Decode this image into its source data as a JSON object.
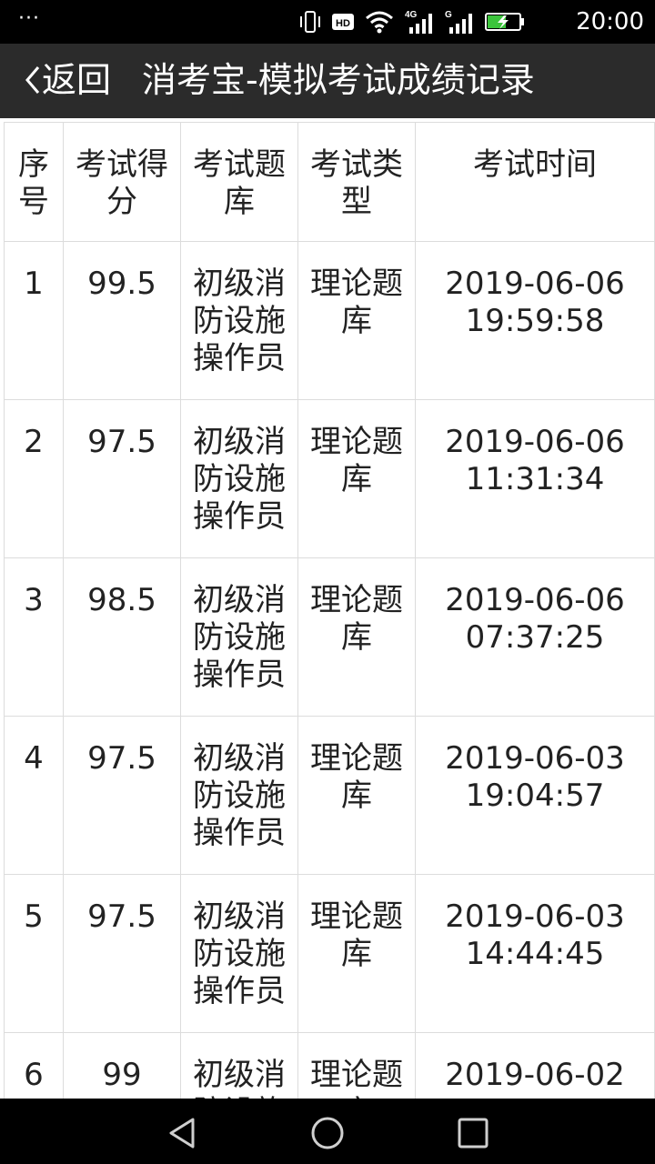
{
  "status_bar": {
    "notification_dots": "···",
    "time": "20:00",
    "icons": [
      "vibrate-icon",
      "hd-icon",
      "wifi-icon",
      "4g-signal-icon",
      "g-signal-icon",
      "battery-charging-icon"
    ],
    "network_labels": {
      "hd": "HD",
      "net1": "4G",
      "net2": "G"
    }
  },
  "header": {
    "back_label": "返回",
    "title": "消考宝-模拟考试成绩记录"
  },
  "table": {
    "columns": [
      "序号",
      "考试得分",
      "考试题库",
      "考试类型",
      "考试时间"
    ],
    "rows": [
      {
        "index": "1",
        "score": "99.5",
        "bank": "初级消防设施操作员",
        "type": "理论题库",
        "time": "2019-06-06 19:59:58"
      },
      {
        "index": "2",
        "score": "97.5",
        "bank": "初级消防设施操作员",
        "type": "理论题库",
        "time": "2019-06-06 11:31:34"
      },
      {
        "index": "3",
        "score": "98.5",
        "bank": "初级消防设施操作员",
        "type": "理论题库",
        "time": "2019-06-06 07:37:25"
      },
      {
        "index": "4",
        "score": "97.5",
        "bank": "初级消防设施操作员",
        "type": "理论题库",
        "time": "2019-06-03 19:04:57"
      },
      {
        "index": "5",
        "score": "97.5",
        "bank": "初级消防设施操作员",
        "type": "理论题库",
        "time": "2019-06-03 14:44:45"
      },
      {
        "index": "6",
        "score": "99",
        "bank": "初级消防设施操作员",
        "type": "理论题库",
        "time": "2019-06-02"
      }
    ]
  },
  "nav_bar": {
    "buttons": [
      "back-triangle-icon",
      "home-circle-icon",
      "recents-square-icon"
    ]
  }
}
